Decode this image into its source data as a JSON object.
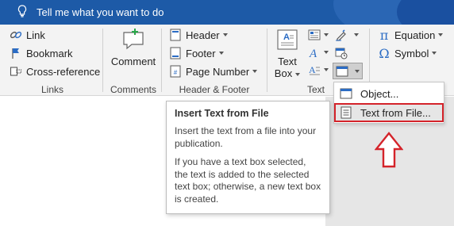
{
  "search": {
    "text": "Tell me what you want to do"
  },
  "groups": {
    "links": {
      "label": "Links",
      "link": "Link",
      "bookmark": "Bookmark",
      "cross_reference": "Cross-reference"
    },
    "comments": {
      "label": "Comments",
      "comment": "Comment"
    },
    "header_footer": {
      "label": "Header & Footer",
      "header": "Header",
      "footer": "Footer",
      "page_number": "Page Number"
    },
    "text": {
      "label": "Text",
      "text_box_line1": "Text",
      "text_box_line2": "Box"
    },
    "symbols": {
      "equation": "Equation",
      "symbol": "Symbol"
    }
  },
  "object_menu": {
    "items": [
      {
        "label": "Object..."
      },
      {
        "label": "Text from File..."
      }
    ]
  },
  "tooltip": {
    "title": "Insert Text from File",
    "p1": "Insert the text from a file into your publication.",
    "p2": "If you have a text box selected, the text is added to the selected text box; otherwise, a new text box is created."
  },
  "colors": {
    "title_bar": "#1d5aa7",
    "accent_icon": "#2b6cc4",
    "highlight": "#d4232a"
  }
}
